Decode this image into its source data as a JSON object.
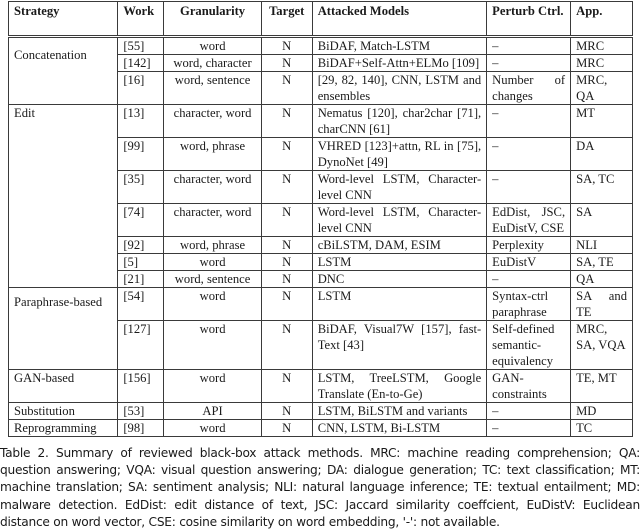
{
  "table": {
    "headers": {
      "strategy": "Strategy",
      "work": "Work",
      "granularity": "Granularity",
      "target": "Target",
      "models": "Attacked Models",
      "perturb": "Perturb Ctrl.",
      "app": "App."
    },
    "groups": [
      {
        "strategy": "Concatenation",
        "rows": [
          {
            "work": "[55]",
            "granularity": "word",
            "target": "N",
            "models": "BiDAF, Match-LSTM",
            "perturb": "–",
            "app": "MRC"
          },
          {
            "work": "[142]",
            "granularity": "word, character",
            "target": "N",
            "models": "BiDAF+Self-Attn+ELMo [109]",
            "perturb": "–",
            "app": "MRC"
          },
          {
            "work": "[16]",
            "granularity": "word, sentence",
            "target": "N",
            "models": "[29, 82, 140], CNN, LSTM and ensembles",
            "perturb": "Number of changes",
            "app": "MRC, QA"
          }
        ]
      },
      {
        "strategy": "Edit",
        "rows": [
          {
            "work": "[13]",
            "granularity": "character, word",
            "target": "N",
            "models": "Nematus [120], char2char [71], charCNN [61]",
            "perturb": "–",
            "app": "MT"
          },
          {
            "work": "[99]",
            "granularity": "word, phrase",
            "target": "N",
            "models": "VHRED [123]+attn, RL in [75], DynoNet [49]",
            "perturb": "–",
            "app": "DA"
          },
          {
            "work": "[35]",
            "granularity": "character, word",
            "target": "N",
            "models": "Word-level LSTM, Character-level CNN",
            "perturb": "–",
            "app": "SA, TC"
          },
          {
            "work": "[74]",
            "granularity": "character, word",
            "target": "N",
            "models": "Word-level LSTM, Character-level CNN",
            "perturb": "EdDist, JSC, EuDistV, CSE",
            "app": "SA"
          },
          {
            "work": "[92]",
            "granularity": "word, phrase",
            "target": "N",
            "models": "cBiLSTM, DAM, ESIM",
            "perturb": "Perplexity",
            "app": "NLI"
          },
          {
            "work": "[5]",
            "granularity": "word",
            "target": "N",
            "models": "LSTM",
            "perturb": "EuDistV",
            "app": "SA, TE"
          },
          {
            "work": "[21]",
            "granularity": "word, sentence",
            "target": "N",
            "models": "DNC",
            "perturb": "–",
            "app": "QA"
          }
        ]
      },
      {
        "strategy": "Paraphrase-based",
        "rows": [
          {
            "work": "[54]",
            "granularity": "word",
            "target": "N",
            "models": "LSTM",
            "perturb": "Syntax-ctrl paraphrase",
            "app": "SA and TE"
          },
          {
            "work": "[127]",
            "granularity": "word",
            "target": "N",
            "models": "BiDAF, Visual7W [157], fast-Text [43]",
            "perturb": "Self-defined semantic-equivalency",
            "app": "MRC, SA, VQA"
          }
        ]
      },
      {
        "strategy": "GAN-based",
        "rows": [
          {
            "work": "[156]",
            "granularity": "word",
            "target": "N",
            "models": "LSTM, TreeLSTM, Google Translate (En-to-Ge)",
            "perturb": "GAN-constraints",
            "app": "TE, MT"
          }
        ]
      },
      {
        "strategy": "Substitution",
        "rows": [
          {
            "work": "[53]",
            "granularity": "API",
            "target": "N",
            "models": "LSTM, BiLSTM and variants",
            "perturb": "–",
            "app": "MD"
          }
        ]
      },
      {
        "strategy": "Reprogramming",
        "rows": [
          {
            "work": "[98]",
            "granularity": "word",
            "target": "N",
            "models": "CNN, LSTM, Bi-LSTM",
            "perturb": "–",
            "app": "TC"
          }
        ]
      }
    ]
  },
  "caption": "Table 2.  Summary of reviewed black-box attack methods. MRC: machine reading comprehension; QA: question answering; VQA: visual question answering; DA: dialogue generation; TC: text classification; MT: machine translation; SA: sentiment analysis; NLI: natural language inference; TE: textual entailment; MD: malware detection. EdDist: edit distance of text, JSC: Jaccard similarity coeffcient, EuDistV: Euclidean distance on word vector, CSE: cosine similarity on word embedding, '-': not available."
}
